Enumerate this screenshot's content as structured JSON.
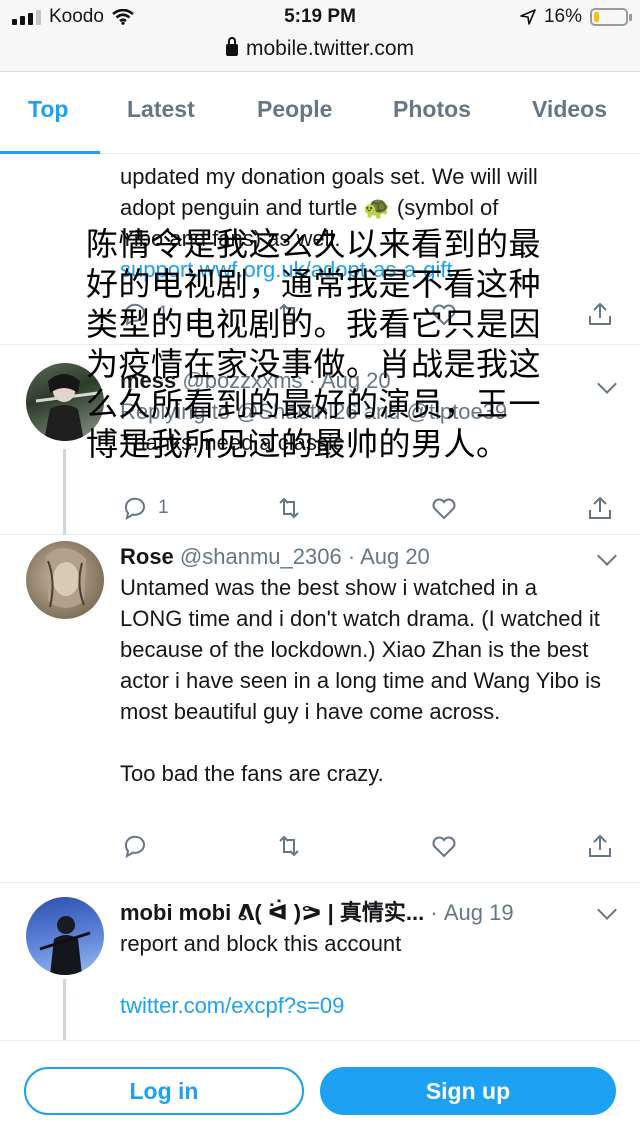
{
  "status_bar": {
    "carrier": "Koodo",
    "time": "5:19 PM",
    "battery": "16%",
    "battery_level": 0.16
  },
  "browser": {
    "url": "mobile.twitter.com"
  },
  "tabs": [
    {
      "label": "Top",
      "active": true
    },
    {
      "label": "Latest"
    },
    {
      "label": "People"
    },
    {
      "label": "Photos"
    },
    {
      "label": "Videos"
    }
  ],
  "tweets": [
    {
      "text_lines": [
        "updated my donation goals set. We will will",
        "adopt penguin and turtle 🐢 (symbol of",
        "Yibo and fans) as well."
      ],
      "link": "support.wwf.org.uk/adopt-as-a-gift",
      "reply_count": "1"
    },
    {
      "name": "mess",
      "handle": "@bozzxxms",
      "date": "Aug 20",
      "replying_to": "Replying to @Shaotnl26 and @tiptoe39",
      "text": "Thanks, need a classic",
      "reply_count": "1"
    },
    {
      "name": "Rose",
      "handle": "@shanmu_2306",
      "date": "Aug 20",
      "text": "Untamed was the best show i watched in a LONG time and i don't watch drama. (I watched it because of the lockdown.) Xiao Zhan is the best actor i have seen in a long time and Wang Yibo is most beautiful guy i have come across.",
      "text2": "Too bad the fans are crazy."
    },
    {
      "name": "mobi mobi ᕕ( ᐛ )ᕗ | 真情实...",
      "date": "Aug 19",
      "text": "report and block this account",
      "link": "twitter.com/excpf?s=09"
    }
  ],
  "overlay_caption": [
    "陈情令是我这么久以来看到的最",
    "好的电视剧，通常我是不看这种",
    "类型的电视剧的。我看它只是因",
    "为疫情在家没事做。肖战是我这",
    "么久所看到的最好的演员，王一",
    "博是我所见过的最帅的男人。"
  ],
  "bottom": {
    "login": "Log in",
    "signup": "Sign up"
  },
  "colors": {
    "accent": "#1da1f2",
    "muted": "#657786"
  }
}
